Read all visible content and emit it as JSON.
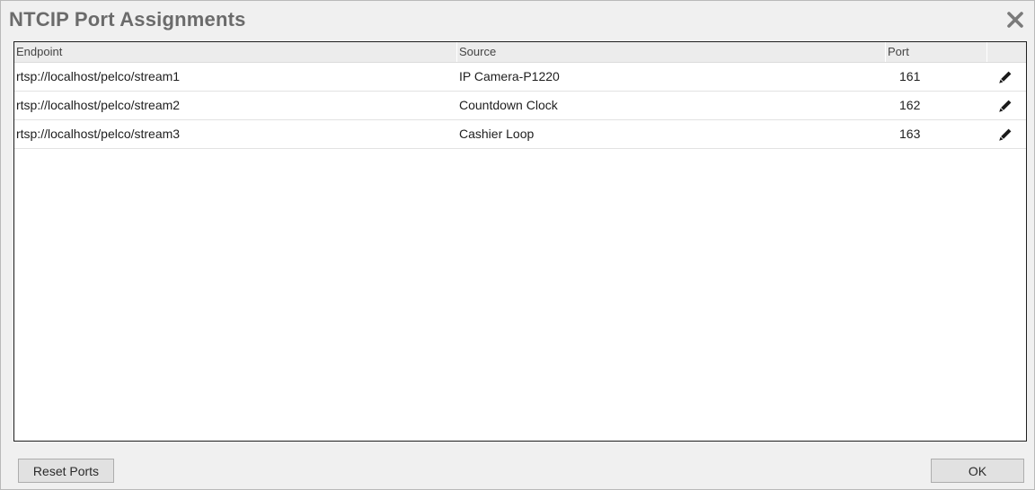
{
  "dialog": {
    "title": "NTCIP Port Assignments",
    "close_icon": "close-icon"
  },
  "table": {
    "columns": [
      "Endpoint",
      "Source",
      "Port",
      ""
    ],
    "rows": [
      {
        "endpoint": "rtsp://localhost/pelco/stream1",
        "source": "IP Camera-P1220",
        "port": "161",
        "action_icon": "pencil-icon"
      },
      {
        "endpoint": "rtsp://localhost/pelco/stream2",
        "source": "Countdown Clock",
        "port": "162",
        "action_icon": "pencil-icon"
      },
      {
        "endpoint": "rtsp://localhost/pelco/stream3",
        "source": "Cashier Loop",
        "port": "163",
        "action_icon": "pencil-icon"
      }
    ]
  },
  "footer": {
    "reset_label": "Reset Ports",
    "ok_label": "OK"
  }
}
